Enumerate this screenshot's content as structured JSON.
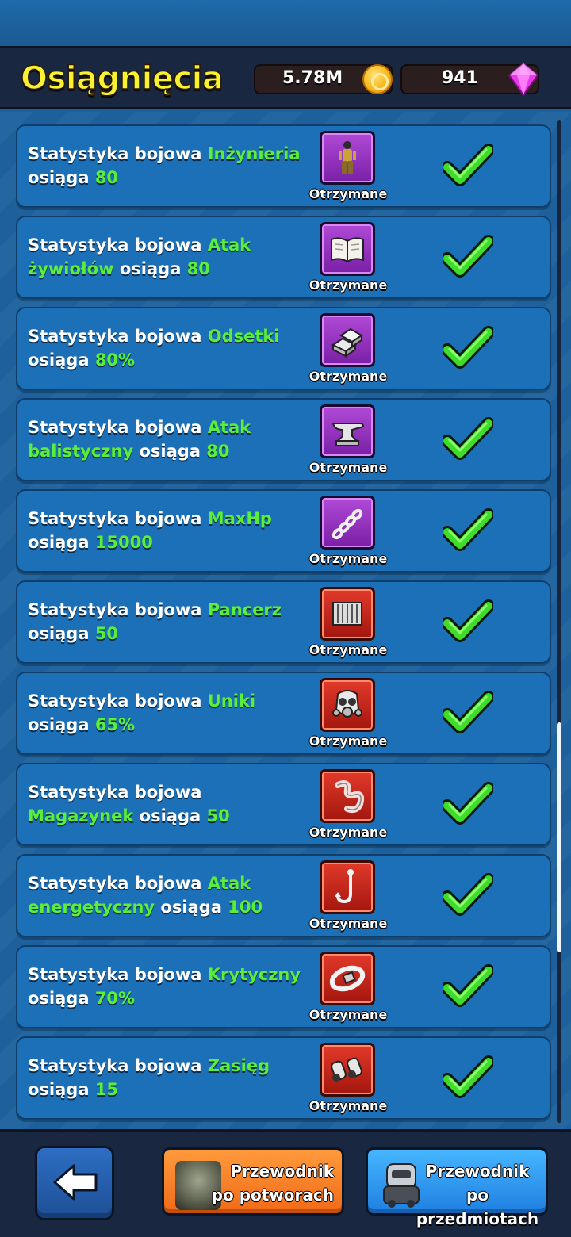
{
  "header": {
    "title": "Osiągnięcia",
    "coins": "5.78M",
    "gems": "941"
  },
  "achievements": [
    {
      "prefix": "Statystyka bojowa ",
      "stat": "Inżynieria",
      "mid": " osiąga ",
      "value": "80",
      "status": "Otrzymane",
      "reward_icon": "engineer-figure-icon",
      "reward_color": "purple"
    },
    {
      "prefix": "Statystyka bojowa ",
      "stat": "Atak żywiołów",
      "mid": " osiąga ",
      "value": "80",
      "status": "Otrzymane",
      "reward_icon": "open-book-icon",
      "reward_color": "purple"
    },
    {
      "prefix": "Statystyka bojowa ",
      "stat": "Odsetki",
      "mid": " osiąga ",
      "value": "80%",
      "status": "Otrzymane",
      "reward_icon": "gold-bars-icon",
      "reward_color": "purple"
    },
    {
      "prefix": "Statystyka bojowa ",
      "stat": "Atak balistyczny",
      "mid": " osiąga ",
      "value": "80",
      "status": "Otrzymane",
      "reward_icon": "anvil-icon",
      "reward_color": "purple"
    },
    {
      "prefix": "Statystyka bojowa ",
      "stat": "MaxHp",
      "mid": " osiąga ",
      "value": "15000",
      "status": "Otrzymane",
      "reward_icon": "chain-icon",
      "reward_color": "purple"
    },
    {
      "prefix": "Statystyka bojowa ",
      "stat": "Pancerz",
      "mid": " osiąga ",
      "value": "50",
      "status": "Otrzymane",
      "reward_icon": "armor-plate-icon",
      "reward_color": "red"
    },
    {
      "prefix": "Statystyka bojowa ",
      "stat": "Uniki",
      "mid": " osiąga ",
      "value": "65%",
      "status": "Otrzymane",
      "reward_icon": "gas-mask-icon",
      "reward_color": "red"
    },
    {
      "prefix": "Statystyka bojowa ",
      "stat": "Magazynek",
      "mid": " osiąga ",
      "value": "50",
      "status": "Otrzymane",
      "reward_icon": "worm-icon",
      "reward_color": "red"
    },
    {
      "prefix": "Statystyka bojowa ",
      "stat": "Atak energetyczny",
      "mid": " osiąga ",
      "value": "100",
      "status": "Otrzymane",
      "reward_icon": "hook-icon",
      "reward_color": "red"
    },
    {
      "prefix": "Statystyka bojowa ",
      "stat": "Krytyczny",
      "mid": " osiąga ",
      "value": "70%",
      "status": "Otrzymane",
      "reward_icon": "belt-icon",
      "reward_color": "red"
    },
    {
      "prefix": "Statystyka bojowa ",
      "stat": "Zasięg",
      "mid": " osiąga ",
      "value": "15",
      "status": "Otrzymane",
      "reward_icon": "binoculars-icon",
      "reward_color": "red"
    }
  ],
  "footer": {
    "monsters_guide": "Przewodnik po potworach",
    "items_guide": "Przewodnik po przedmiotach"
  },
  "colors": {
    "highlight": "#5af03a",
    "title": "#f8f232",
    "row_bg": "#1c70b7"
  }
}
